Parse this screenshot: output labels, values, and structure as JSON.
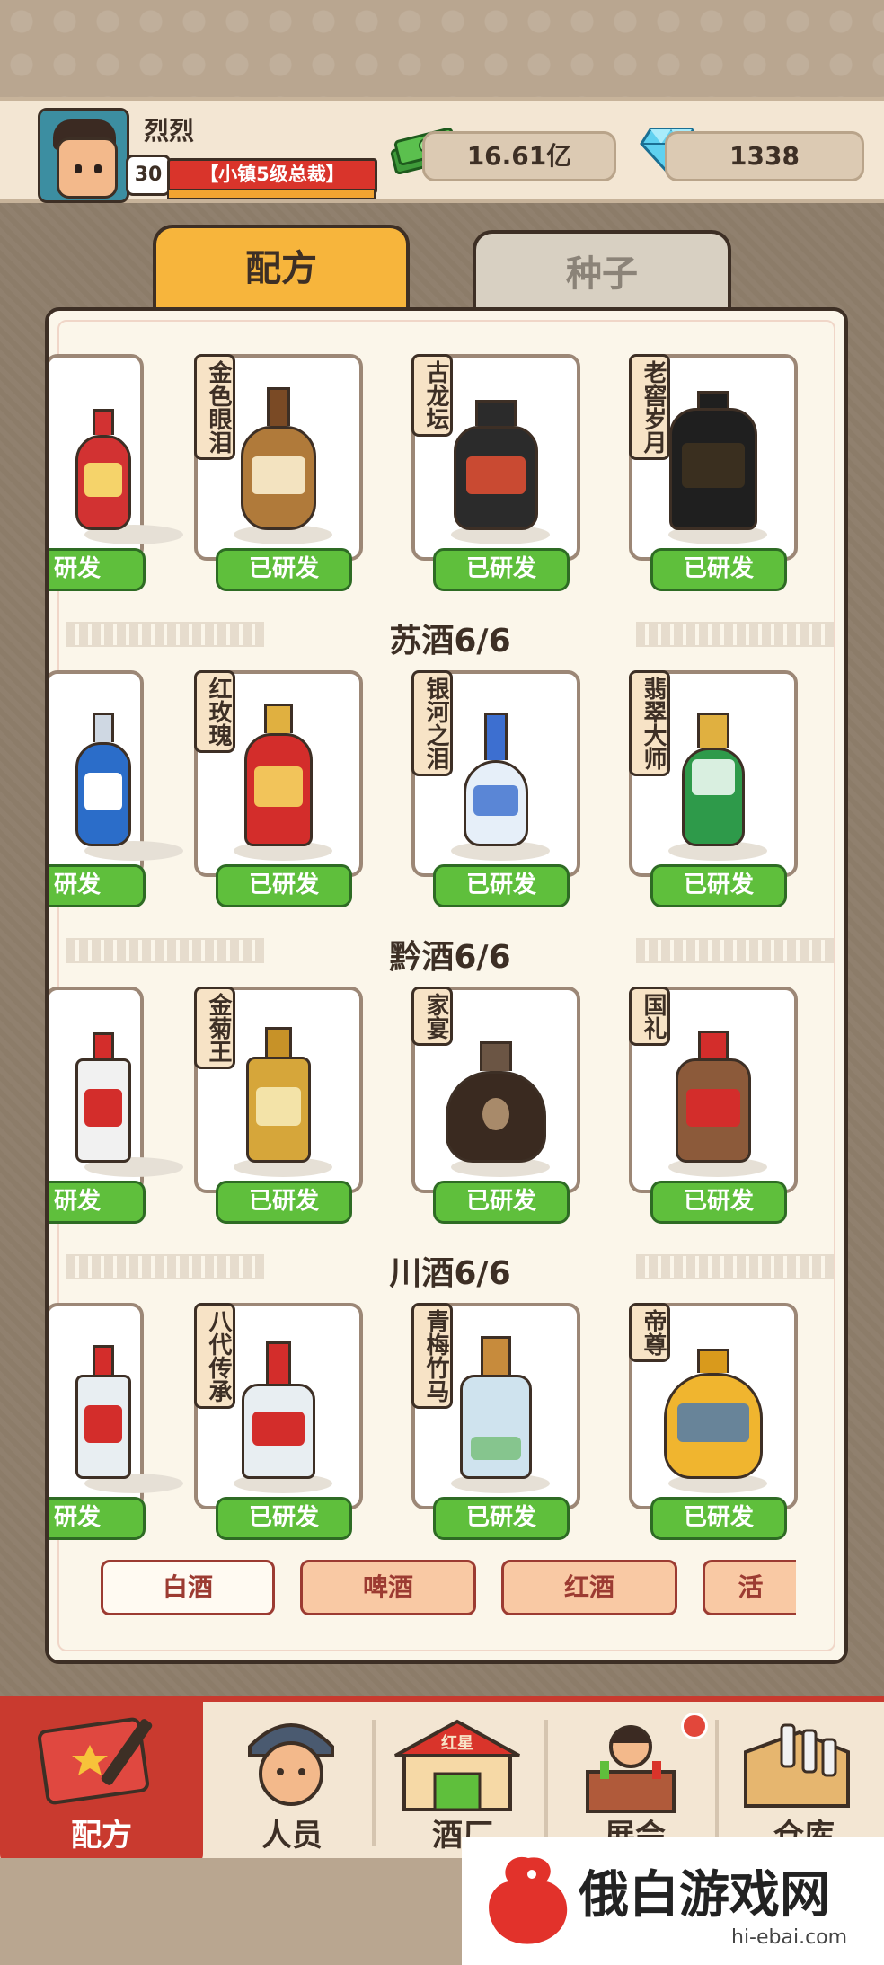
{
  "header": {
    "username": "烈烈",
    "level": "30",
    "title": "【小镇5级总裁】",
    "money": "16.61亿",
    "gems": "1338"
  },
  "tabs": {
    "recipe": "配方",
    "seed": "种子"
  },
  "sections": [
    {
      "title": "",
      "items": [
        {
          "name": "",
          "partial": true,
          "bottle_color": "#d23232"
        },
        {
          "name": "金色眼泪",
          "bottle_color": "#b07a3a"
        },
        {
          "name": "古龙坛",
          "bottle_color": "#2b2b2b"
        },
        {
          "name": "老窖岁月",
          "bottle_color": "#1f1f1f"
        }
      ]
    },
    {
      "title": "苏酒6/6",
      "items": [
        {
          "name": "",
          "partial": true,
          "bottle_color": "#2b6dc9"
        },
        {
          "name": "红玫瑰",
          "bottle_color": "#d32d2b"
        },
        {
          "name": "银河之泪",
          "bottle_color": "#cfe0f3"
        },
        {
          "name": "翡翠大师",
          "bottle_color": "#2e9a4a"
        }
      ]
    },
    {
      "title": "黔酒6/6",
      "items": [
        {
          "name": "",
          "partial": true,
          "bottle_color": "#f1f1f1"
        },
        {
          "name": "金菊王",
          "bottle_color": "#d6a63a"
        },
        {
          "name": "家宴",
          "bottle_color": "#3a2a20"
        },
        {
          "name": "国礼",
          "bottle_color": "#8c5a3a"
        }
      ]
    },
    {
      "title": "川酒6/6",
      "items": [
        {
          "name": "",
          "partial": true,
          "bottle_color": "#e8eef2"
        },
        {
          "name": "八代传承",
          "bottle_color": "#e8eef2"
        },
        {
          "name": "青梅竹马",
          "bottle_color": "#cfe3ee"
        },
        {
          "name": "帝尊",
          "bottle_color": "#f0b52f"
        }
      ]
    }
  ],
  "developed_label": "已研发",
  "developed_label_partial": "研发",
  "categories": [
    {
      "label": "白酒",
      "active": true
    },
    {
      "label": "啤酒",
      "active": false
    },
    {
      "label": "红酒",
      "active": false
    },
    {
      "label": "活",
      "active": false
    }
  ],
  "nav": [
    {
      "label": "配方",
      "icon": "notebook-icon",
      "active": true
    },
    {
      "label": "人员",
      "icon": "worker-icon",
      "active": false
    },
    {
      "label": "酒厂",
      "icon": "factory-icon",
      "active": false
    },
    {
      "label": "展会",
      "icon": "fair-icon",
      "active": false
    },
    {
      "label": "仓库",
      "icon": "warehouse-icon",
      "active": false
    }
  ],
  "factory_sign": "红星",
  "watermark": {
    "text": "俄白游戏网",
    "url": "hi-ebai.com"
  },
  "colors": {
    "accent": "#c93a2f",
    "developed_green": "#5fbf3c",
    "tab_active": "#f7b53c"
  }
}
